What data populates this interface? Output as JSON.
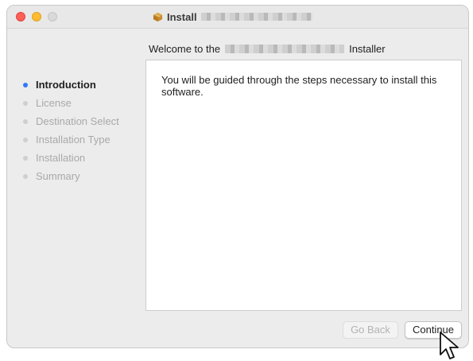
{
  "window": {
    "title": "Install"
  },
  "header": {
    "prefix": "Welcome to the",
    "suffix": "Installer"
  },
  "steps": [
    {
      "label": "Introduction",
      "active": true
    },
    {
      "label": "License",
      "active": false
    },
    {
      "label": "Destination Select",
      "active": false
    },
    {
      "label": "Installation Type",
      "active": false
    },
    {
      "label": "Installation",
      "active": false
    },
    {
      "label": "Summary",
      "active": false
    }
  ],
  "content": {
    "message": "You will be guided through the steps necessary to install this software."
  },
  "buttons": {
    "back_label": "Go Back",
    "continue_label": "Continue"
  },
  "colors": {
    "accent": "#3478f6",
    "close": "#fe5f57",
    "minimize": "#febc2e"
  },
  "icons": {
    "title_icon": "package-icon",
    "pointer": "mouse-cursor-icon"
  }
}
